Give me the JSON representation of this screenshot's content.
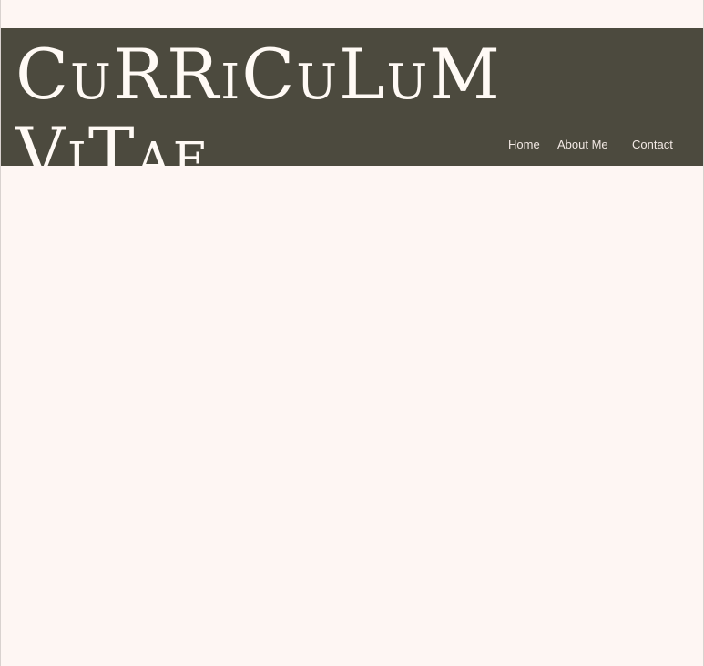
{
  "site": {
    "title": "CuRRiCuLuM ViTae"
  },
  "nav": {
    "items": [
      {
        "label": "Home"
      },
      {
        "label": "About Me"
      },
      {
        "label": "Contact"
      }
    ]
  },
  "colors": {
    "header_background": "#4c4a3e",
    "page_background": "#fef6f3",
    "title_text": "#fffaf5",
    "nav_text": "#f2e9e4"
  }
}
